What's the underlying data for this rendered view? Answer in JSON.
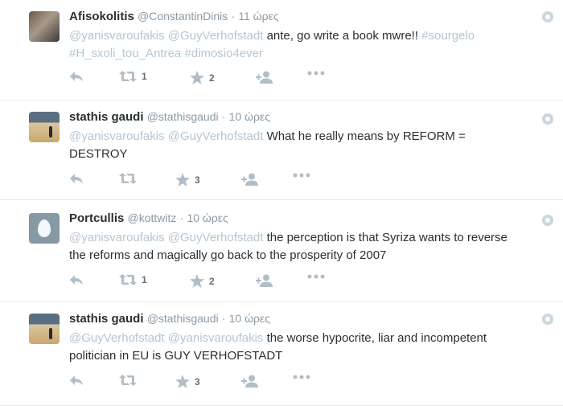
{
  "tweets": [
    {
      "name": "Afisokolitis",
      "handle": "@ConstantinDinis",
      "time": "11 ώρες",
      "text": [
        {
          "t": "@yanisvaroufakis",
          "k": "mention"
        },
        {
          "t": " ",
          "k": "text"
        },
        {
          "t": "@GuyVerhofstadt",
          "k": "mention"
        },
        {
          "t": "  ante, go write a book mwre!! ",
          "k": "text"
        },
        {
          "t": "#sourgelo",
          "k": "tag"
        },
        {
          "t": " ",
          "k": "text"
        },
        {
          "t": "#H_sxoli_tou_Antrea",
          "k": "tag"
        },
        {
          "t": " ",
          "k": "text"
        },
        {
          "t": "#dimosio4ever",
          "k": "tag"
        }
      ],
      "retweets": "1",
      "favorites": "2"
    },
    {
      "name": "stathis gaudi",
      "handle": "@stathisgaudi",
      "time": "10 ώρες",
      "text": [
        {
          "t": "@yanisvaroufakis",
          "k": "mention"
        },
        {
          "t": " ",
          "k": "text"
        },
        {
          "t": "@GuyVerhofstadt",
          "k": "mention"
        },
        {
          "t": " What he really means by REFORM = DESTROY",
          "k": "text"
        }
      ],
      "retweets": "",
      "favorites": "3"
    },
    {
      "name": "Portcullis",
      "handle": "@kottwitz",
      "time": "10 ώρες",
      "text": [
        {
          "t": "@yanisvaroufakis",
          "k": "mention"
        },
        {
          "t": " ",
          "k": "text"
        },
        {
          "t": "@GuyVerhofstadt",
          "k": "mention"
        },
        {
          "t": " the perception is that Syriza wants to reverse the reforms and magically go back to the prosperity of 2007",
          "k": "text"
        }
      ],
      "retweets": "1",
      "favorites": "2"
    },
    {
      "name": "stathis gaudi",
      "handle": "@stathisgaudi",
      "time": "10 ώρες",
      "text": [
        {
          "t": "@GuyVerhofstadt",
          "k": "mention"
        },
        {
          "t": " ",
          "k": "text"
        },
        {
          "t": "@yanisvaroufakis",
          "k": "mention"
        },
        {
          "t": " the worse hypocrite, liar and incompetent politician in EU is GUY VERHOFSTADT",
          "k": "text"
        }
      ],
      "retweets": "",
      "favorites": "3"
    }
  ],
  "separator": "·",
  "icons": {
    "reply": "reply-icon",
    "retweet": "retweet-icon",
    "favorite": "star-icon",
    "follow": "follow-icon",
    "more": "more-icon",
    "settings": "gear-icon"
  }
}
